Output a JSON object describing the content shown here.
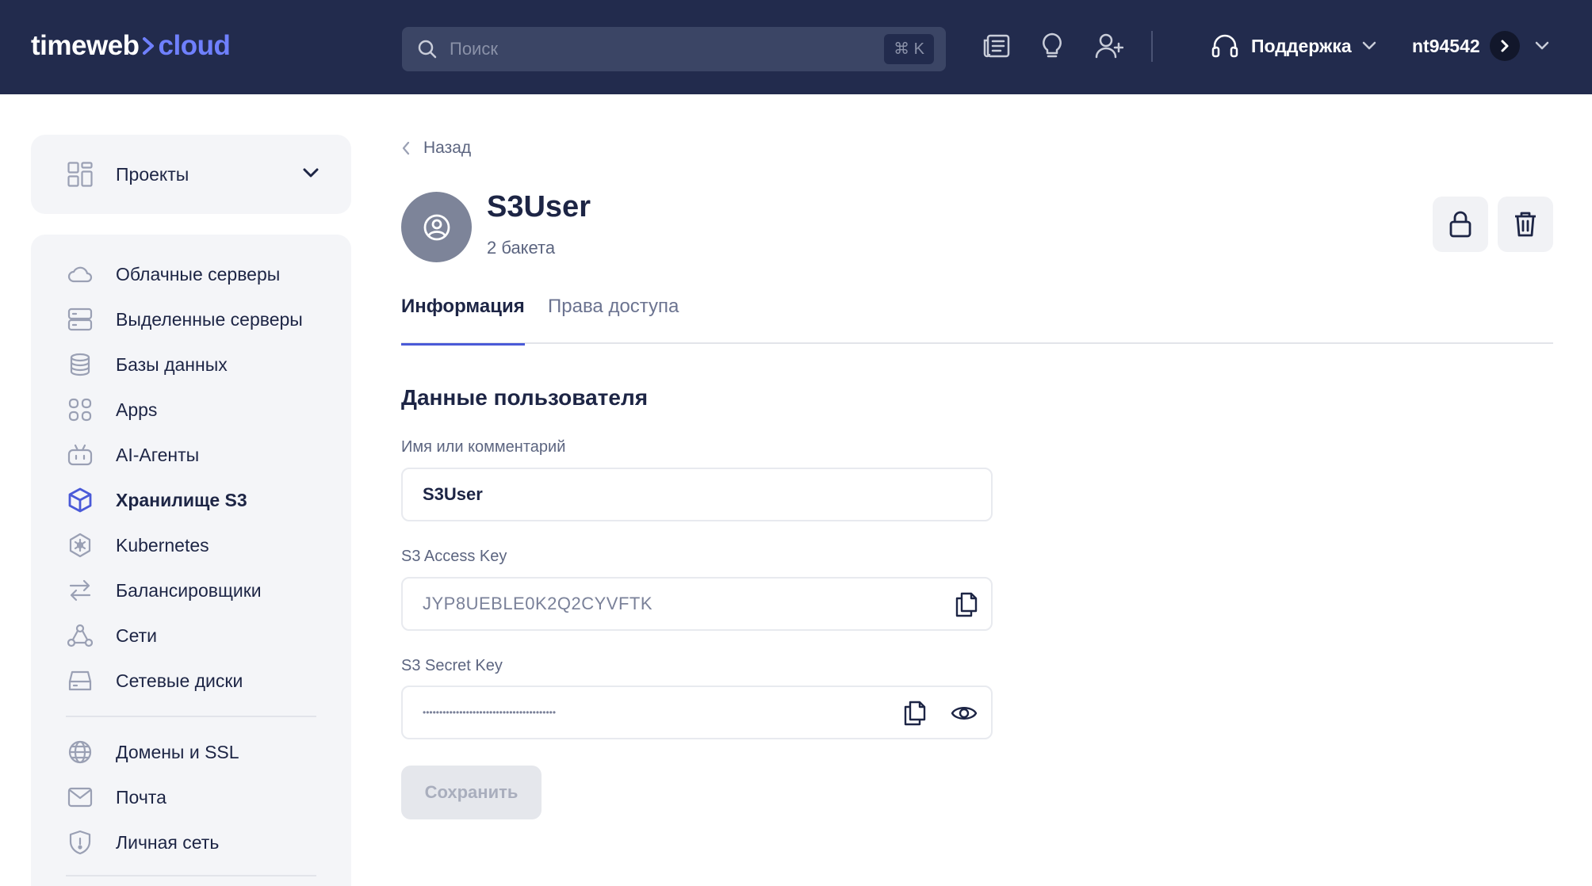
{
  "header": {
    "logo_main": "timeweb",
    "logo_accent": "cloud",
    "search_placeholder": "Поиск",
    "search_shortcut": "⌘ K",
    "support_label": "Поддержка",
    "account_name": "nt94542",
    "icons": [
      "news-icon",
      "idea-icon",
      "add-user-icon",
      "headset-icon"
    ]
  },
  "sidebar": {
    "projects_label": "Проекты",
    "items": [
      {
        "label": "Облачные серверы",
        "icon": "cloud-icon"
      },
      {
        "label": "Выделенные серверы",
        "icon": "server-icon"
      },
      {
        "label": "Базы данных",
        "icon": "database-icon"
      },
      {
        "label": "Apps",
        "icon": "apps-icon"
      },
      {
        "label": "AI-Агенты",
        "icon": "robot-icon"
      },
      {
        "label": "Хранилище S3",
        "icon": "cube-icon",
        "active": true
      },
      {
        "label": "Kubernetes",
        "icon": "kubernetes-icon"
      },
      {
        "label": "Балансировщики",
        "icon": "arrows-icon"
      },
      {
        "label": "Сети",
        "icon": "network-icon"
      },
      {
        "label": "Сетевые диски",
        "icon": "disk-icon"
      }
    ],
    "items2": [
      {
        "label": "Домены и SSL",
        "icon": "globe-icon"
      },
      {
        "label": "Почта",
        "icon": "mail-icon"
      },
      {
        "label": "Личная сеть",
        "icon": "shield-icon"
      }
    ]
  },
  "main": {
    "back_label": "Назад",
    "user_title": "S3User",
    "user_subtitle": "2 бакета",
    "tabs": [
      {
        "label": "Информация",
        "active": true
      },
      {
        "label": "Права доступа",
        "active": false
      }
    ],
    "section_title": "Данные пользователя",
    "fields": {
      "name_label": "Имя или комментарий",
      "name_value": "S3User",
      "access_label": "S3 Access Key",
      "access_value": "JYP8UEBLE0K2Q2CYVFTK",
      "secret_label": "S3 Secret Key",
      "secret_value": "••••••••••••••••••••••••••••••••••••••••"
    },
    "save_label": "Сохранить"
  },
  "colors": {
    "header_bg": "#222b4d",
    "accent": "#4a5ad8",
    "logo_accent": "#6f80ff",
    "sidebar_bg": "#f4f5f8",
    "text_dark": "#1d2545"
  }
}
